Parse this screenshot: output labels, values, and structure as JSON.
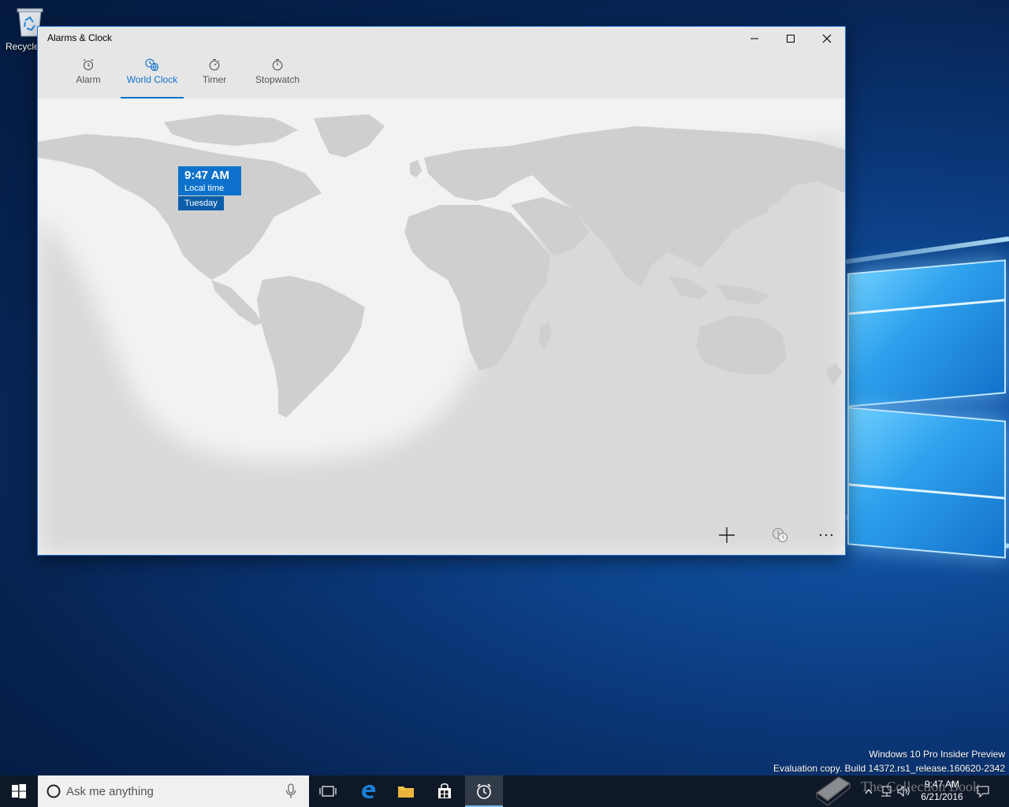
{
  "desktop": {
    "recycle_bin_label": "Recycle",
    "watermark_line1": "Windows 10 Pro Insider Preview",
    "watermark_line2": "Evaluation copy. Build 14372.rs1_release.160620-2342",
    "overlay_text": "The Collection Book"
  },
  "window": {
    "title": "Alarms & Clock",
    "tabs": [
      {
        "label": "Alarm",
        "icon": "alarm-clock-icon",
        "active": false
      },
      {
        "label": "World Clock",
        "icon": "world-clock-icon",
        "active": true
      },
      {
        "label": "Timer",
        "icon": "timer-icon",
        "active": false
      },
      {
        "label": "Stopwatch",
        "icon": "stopwatch-icon",
        "active": false
      }
    ],
    "local_clock": {
      "time": "9:47 AM",
      "label": "Local time",
      "day": "Tuesday"
    },
    "commands": {
      "add": "add-icon",
      "compare": "compare-clocks-icon",
      "more": "more-icon"
    }
  },
  "taskbar": {
    "search_placeholder": "Ask me anything",
    "clock_time": "9:47 AM",
    "clock_date": "6/21/2016",
    "pinned": [
      "task-view-icon",
      "edge-icon",
      "file-explorer-icon",
      "store-icon",
      "alarms-clock-icon"
    ]
  },
  "colors": {
    "accent": "#0e72cc",
    "accent_dark": "#0d5ea8",
    "land": "#d4d4d4",
    "night_shade": "#dcdcdc",
    "map_bg": "#f2f2f2"
  }
}
